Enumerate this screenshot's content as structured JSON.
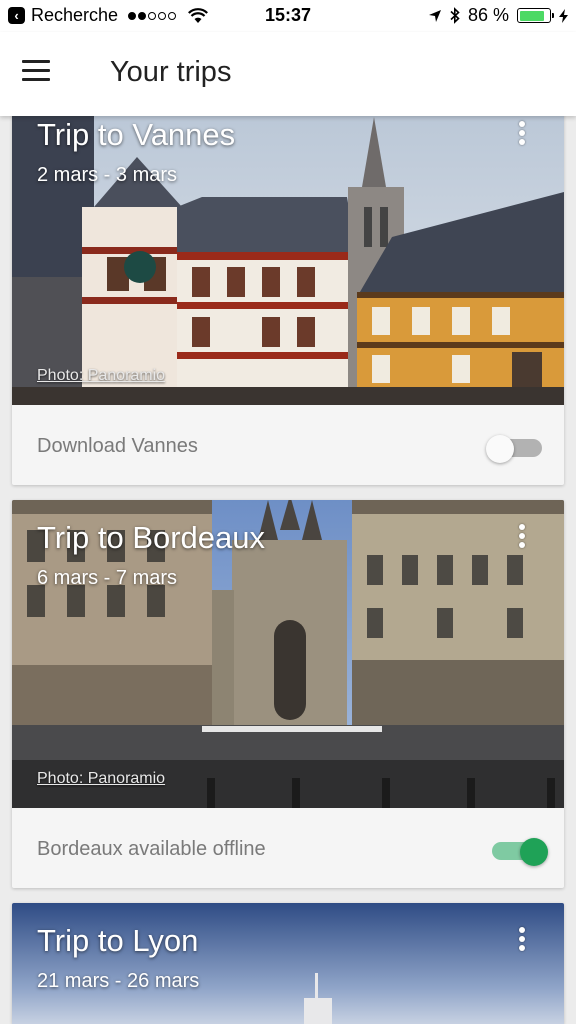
{
  "status_bar": {
    "back_label": "Recherche",
    "time": "15:37",
    "battery": "86 %",
    "icons": [
      "back-arrow-icon",
      "wifi-icon",
      "location-arrow-icon",
      "bluetooth-icon",
      "battery-icon",
      "charging-bolt-icon"
    ]
  },
  "app_bar": {
    "title": "Your trips",
    "menu_icon": "hamburger-menu-icon"
  },
  "trips": [
    {
      "title": "Trip to Vannes",
      "dates": "2 mars - 3 mars",
      "photo_credit": "Photo: Panoramio",
      "footer_label": "Download Vannes",
      "offline_toggle": "off"
    },
    {
      "title": "Trip to Bordeaux",
      "dates": "6 mars - 7 mars",
      "photo_credit": "Photo: Panoramio",
      "footer_label": "Bordeaux available offline",
      "offline_toggle": "on"
    },
    {
      "title": "Trip to Lyon",
      "dates": "21 mars - 26 mars"
    }
  ],
  "colors": {
    "toggle_on": "#1fa257",
    "toggle_on_track": "#7fcaa2",
    "toggle_off_track": "#b2b2b2",
    "battery_fill": "#4cd964"
  }
}
